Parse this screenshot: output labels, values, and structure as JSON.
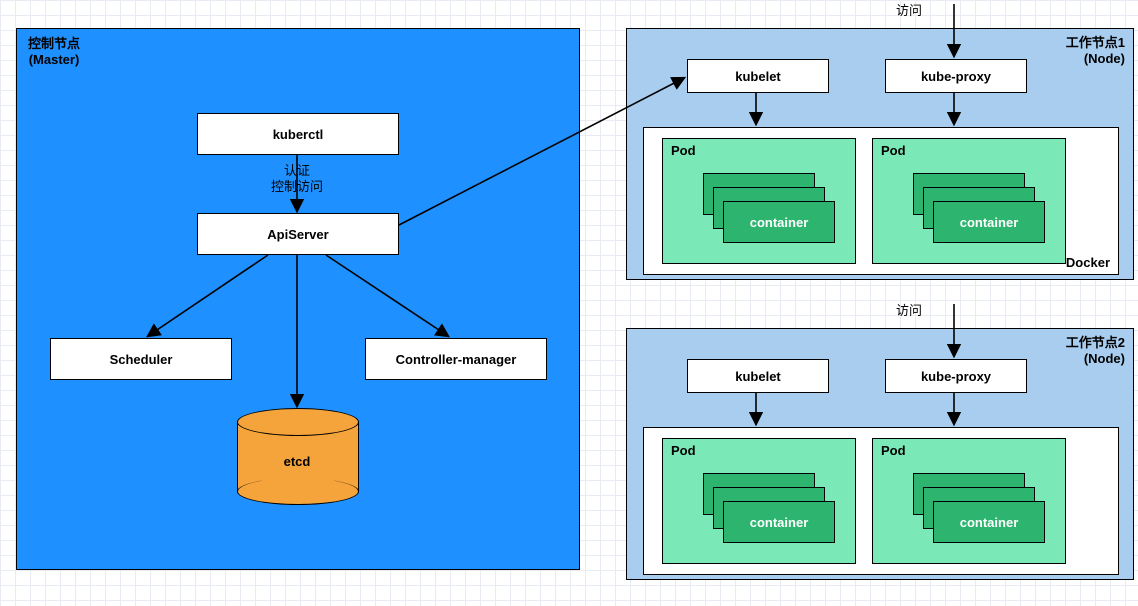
{
  "master": {
    "title": "控制节点\n(Master)",
    "kuberctl": "kuberctl",
    "auth_label": "认证\n控制访问",
    "apiserver": "ApiServer",
    "scheduler": "Scheduler",
    "controller_manager": "Controller-manager",
    "etcd": "etcd"
  },
  "node_common": {
    "access_label": "访问",
    "kubelet": "kubelet",
    "kube_proxy": "kube-proxy",
    "docker": "Docker",
    "pod": "Pod",
    "container": "container"
  },
  "node1": {
    "title": "工作节点1\n(Node)"
  },
  "node2": {
    "title": "工作节点2\n(Node)"
  },
  "colors": {
    "master_bg": "#1e90ff",
    "node_bg": "#a8cdee",
    "pod_bg": "#7be8b7",
    "container_bg": "#2db56f",
    "etcd_fill": "#f5a33b"
  }
}
